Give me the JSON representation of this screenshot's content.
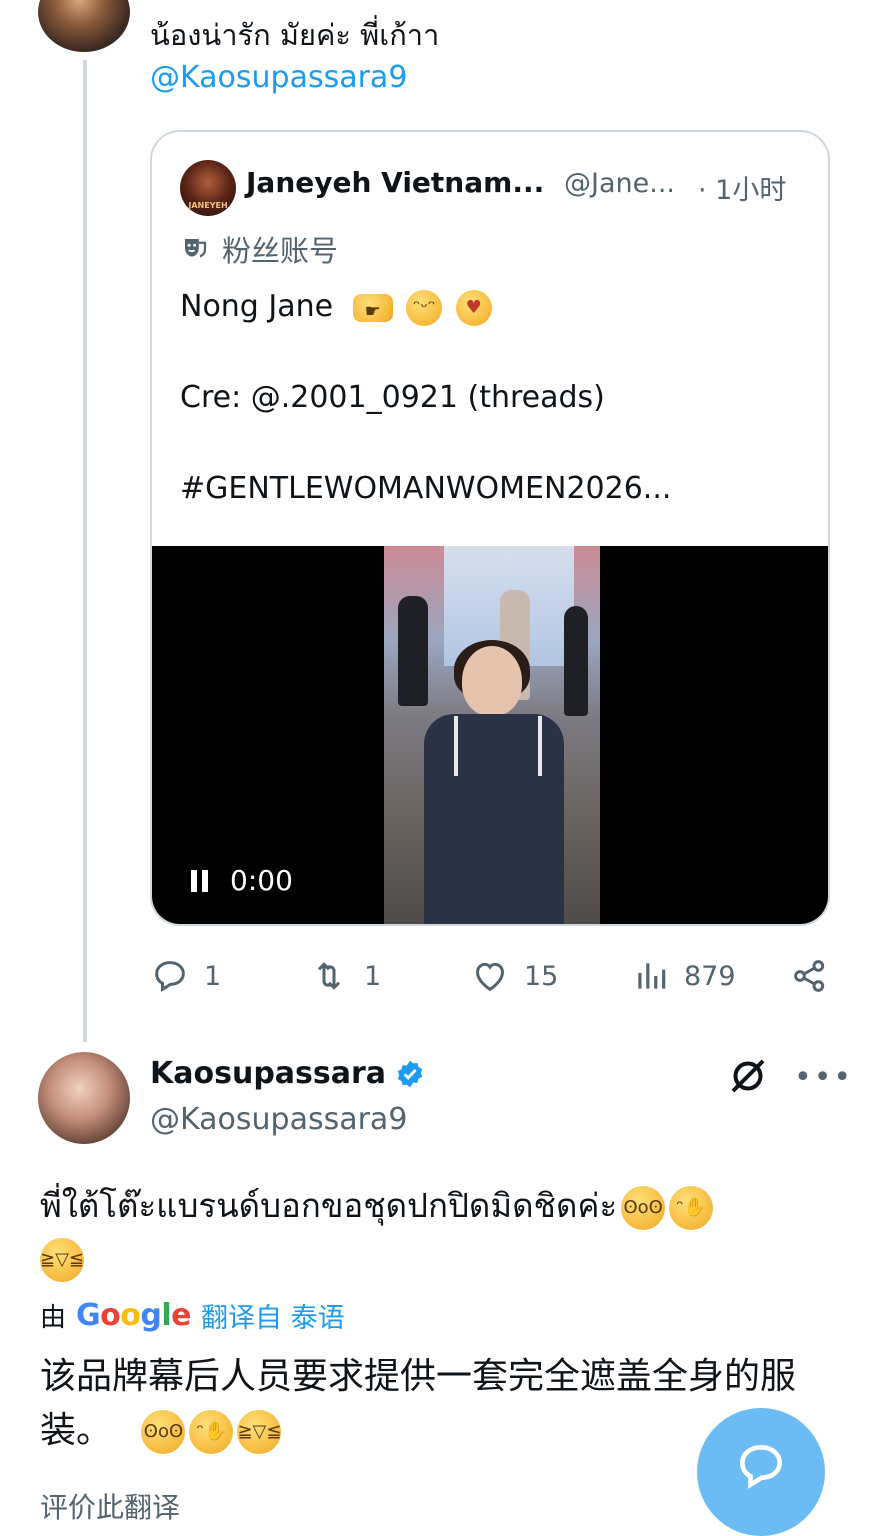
{
  "reply": {
    "text": "น้องน่ารัก มัยค่ะ พี่เก้าา",
    "mention": "@Kaosupassara9"
  },
  "quote": {
    "avatar_caption": "JANEYEH",
    "name": "Janeyeh Vietnam...",
    "handle": "@Jane...",
    "time": "· 1小时",
    "fan_label": "粉丝账号",
    "lines": [
      "Nong Jane",
      "Cre: @.2001_0921 (threads)",
      "#GENTLEWOMANWOMEN2026..."
    ],
    "emoji_names": [
      "backhand-index-pointing-right",
      "pleading-face",
      "face-blowing-kiss"
    ],
    "video": {
      "time": "0:00",
      "state": "playing"
    }
  },
  "actions": {
    "replies": "1",
    "reposts": "1",
    "likes": "15",
    "views": "879"
  },
  "post": {
    "name": "Kaosupassara",
    "handle": "@Kaosupassara9",
    "text": "พี่ใต้โต๊ะแบรนด์บอกขอชุดปกปิดมิดชิดค่ะ",
    "text_emojis": [
      "face-with-open-eyes-and-hand-over-mouth",
      "face-with-hand-over-mouth",
      "face-with-tears-of-joy"
    ],
    "translated_by_prefix": "由",
    "translated_by_brand": "Google",
    "translated_from": "翻译自 泰语",
    "translation": "该品牌幕后人员要求提供一套完全遮盖全身的服装。",
    "bottom_cut_text": "评价此翻译"
  },
  "colors": {
    "accent": "#1d9bf0",
    "secondary_text": "#536471",
    "border": "#cfd9de",
    "fab": "#6bbcf5"
  }
}
